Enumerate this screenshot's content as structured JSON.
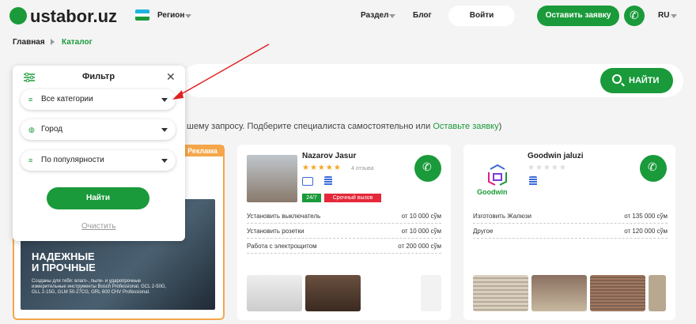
{
  "header": {
    "logo": "ustabor.uz",
    "region": "Регион",
    "nav_section": "Раздел",
    "nav_blog": "Блог",
    "login": "Войти",
    "apply": "Оставить заявку",
    "lang": "RU"
  },
  "breadcrumb": {
    "home": "Главная",
    "current": "Каталог"
  },
  "search": {
    "button": "НАЙТИ"
  },
  "info": {
    "text": "шему запросу. Подберите специалиста самостоятельно или ",
    "link": "Оставьте заявку",
    "end": ")"
  },
  "filter": {
    "title": "Фильтр",
    "category": "Все категории",
    "city": "Город",
    "sort": "По популярности",
    "find": "Найти",
    "clear": "Очистить"
  },
  "ad": {
    "tag": "Реклама",
    "headline1": "НАДЕЖНЫЕ",
    "headline2": "И ПРОЧНЫЕ",
    "sub": "Созданы для тебя: влаго-, пыле- и ударопрочные измерительные инструменты Bosch Professional. GCL 2-50G, GLL 2-15G, GLM 50-27CG, GRL 600 CHV Professional."
  },
  "cards": [
    {
      "name": "Nazarov Jasur",
      "reviews": "4 отзыва",
      "badge": "24/7",
      "urgent": "Срочный вызов",
      "stars": 5,
      "services": [
        {
          "label": "Установить выключатель",
          "price": "от 10 000 сўм"
        },
        {
          "label": "Установить розетки",
          "price": "от 10 000 сўм"
        },
        {
          "label": "Работа с электрощитом",
          "price": "от 200 000 сўм"
        }
      ]
    },
    {
      "name": "Goodwin jaluzi",
      "logo_text": "Goodwin",
      "stars": 0,
      "services": [
        {
          "label": "Изготовить Жалюзи",
          "price": "от 135 000 сўм"
        },
        {
          "label": "Другое",
          "price": "от 120 000 сўм"
        }
      ]
    }
  ],
  "colors": {
    "accent": "#1a9a3a",
    "ad_border": "#f5a64a",
    "urgent": "#e5283a"
  }
}
